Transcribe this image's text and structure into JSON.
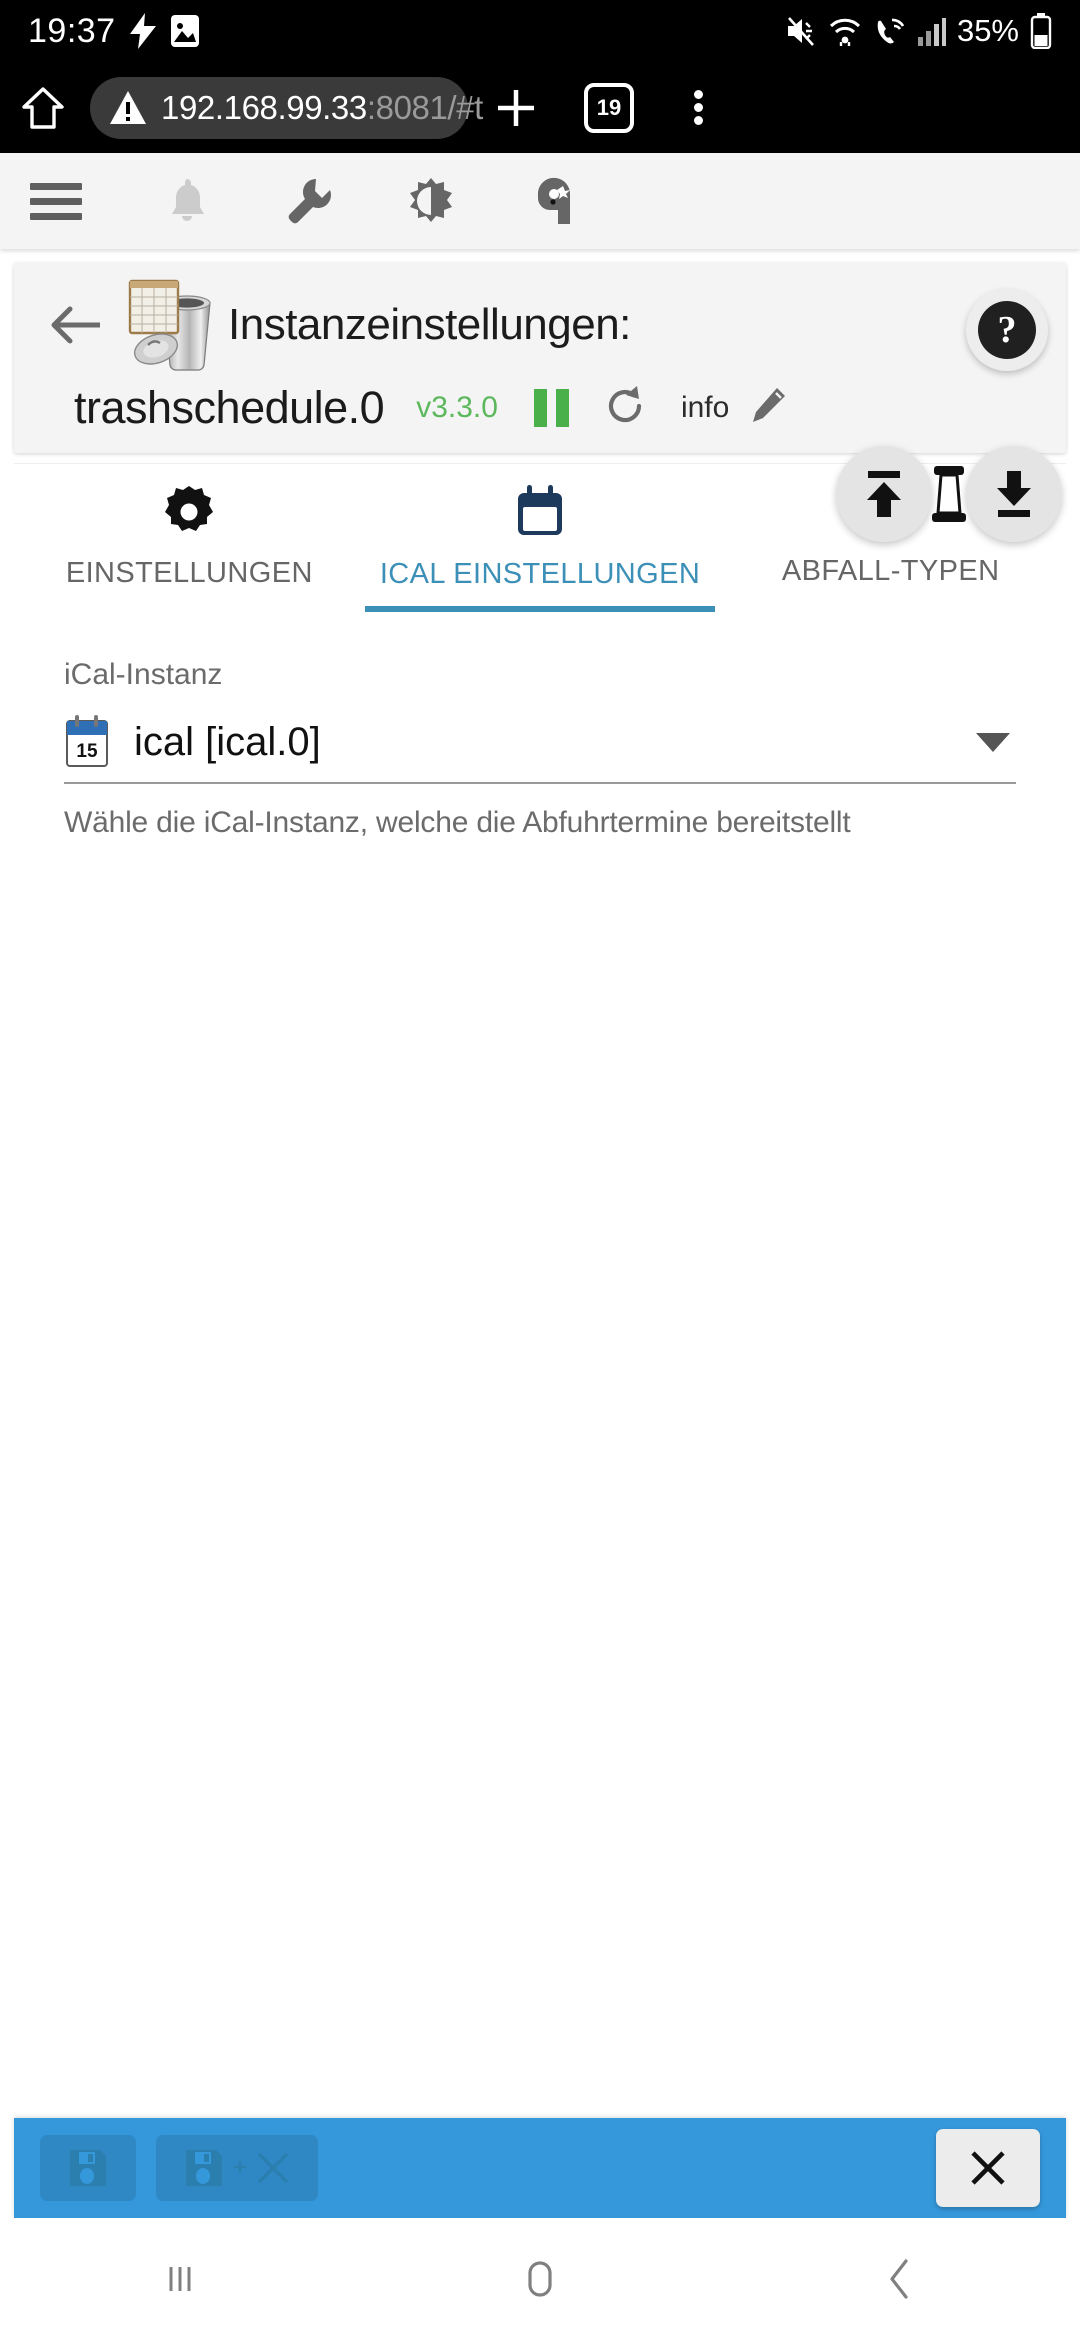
{
  "status_bar": {
    "time": "19:37",
    "battery_percent": "35%",
    "icons": [
      "charging-bolt-icon",
      "screenshot-icon",
      "mute-icon",
      "wifi-icon",
      "wifi-call-icon",
      "signal-icon",
      "battery-icon"
    ]
  },
  "browser": {
    "url_host": "192.168.99.33",
    "url_path": ":8081/#t",
    "security": "insecure-warning",
    "tab_count": "19",
    "home_label": "home-icon",
    "new_tab_label": "new-tab-icon",
    "menu_label": "overflow-menu-icon"
  },
  "app_toolbar": {
    "items": [
      {
        "name": "menu-icon",
        "label": "Menü"
      },
      {
        "name": "bell-icon",
        "label": "Benachrichtigungen"
      },
      {
        "name": "wrench-icon",
        "label": "Experten"
      },
      {
        "name": "theme-icon",
        "label": "Theme"
      },
      {
        "name": "user-icon",
        "label": "Benutzer"
      }
    ]
  },
  "instance_header": {
    "back_label": "back-arrow-icon",
    "title": "Instanzeinstellungen:",
    "adapter_name": "trashschedule.0",
    "version": "v3.3.0",
    "status": "running",
    "help_label": "?",
    "refresh_label": "refresh-icon",
    "info_label": "info",
    "edit_label": "edit-pencil-icon",
    "logo_name": "trashschedule-logo"
  },
  "tabs": [
    {
      "label": "EINSTELLUNGEN",
      "icon": "gear-icon",
      "active": false
    },
    {
      "label": "ICAL EINSTELLUNGEN",
      "icon": "calendar-icon",
      "active": true
    },
    {
      "label": "ABFALL-TYPEN",
      "icon": "trash-types-icon",
      "active": false
    }
  ],
  "fab_cluster": [
    {
      "name": "upload-icon",
      "label": "Hochladen"
    },
    {
      "name": "column-icon",
      "label": "Spalte"
    },
    {
      "name": "download-icon",
      "label": "Herunterladen"
    }
  ],
  "ical_settings": {
    "field_label": "iCal-Instanz",
    "selected_value": "ical [ical.0]",
    "icon": "calendar-day-icon",
    "dropdown_icon": "chevron-down-icon",
    "helper_text": "Wähle die iCal-Instanz, welche die Abfuhrtermine bereitstellt"
  },
  "action_bar": {
    "save_label": "save-icon",
    "save_close_label": "save-and-close-icon",
    "close_label": "×",
    "background": "#3598db"
  },
  "nav_bar": {
    "recents_label": "recents-icon",
    "home_label": "home-circle-icon",
    "back_label": "back-chevron-icon"
  },
  "colors": {
    "accent": "#3598db",
    "tab_active": "#3c90b8",
    "version_green": "#5cb85c",
    "status_green": "#49b04a"
  }
}
